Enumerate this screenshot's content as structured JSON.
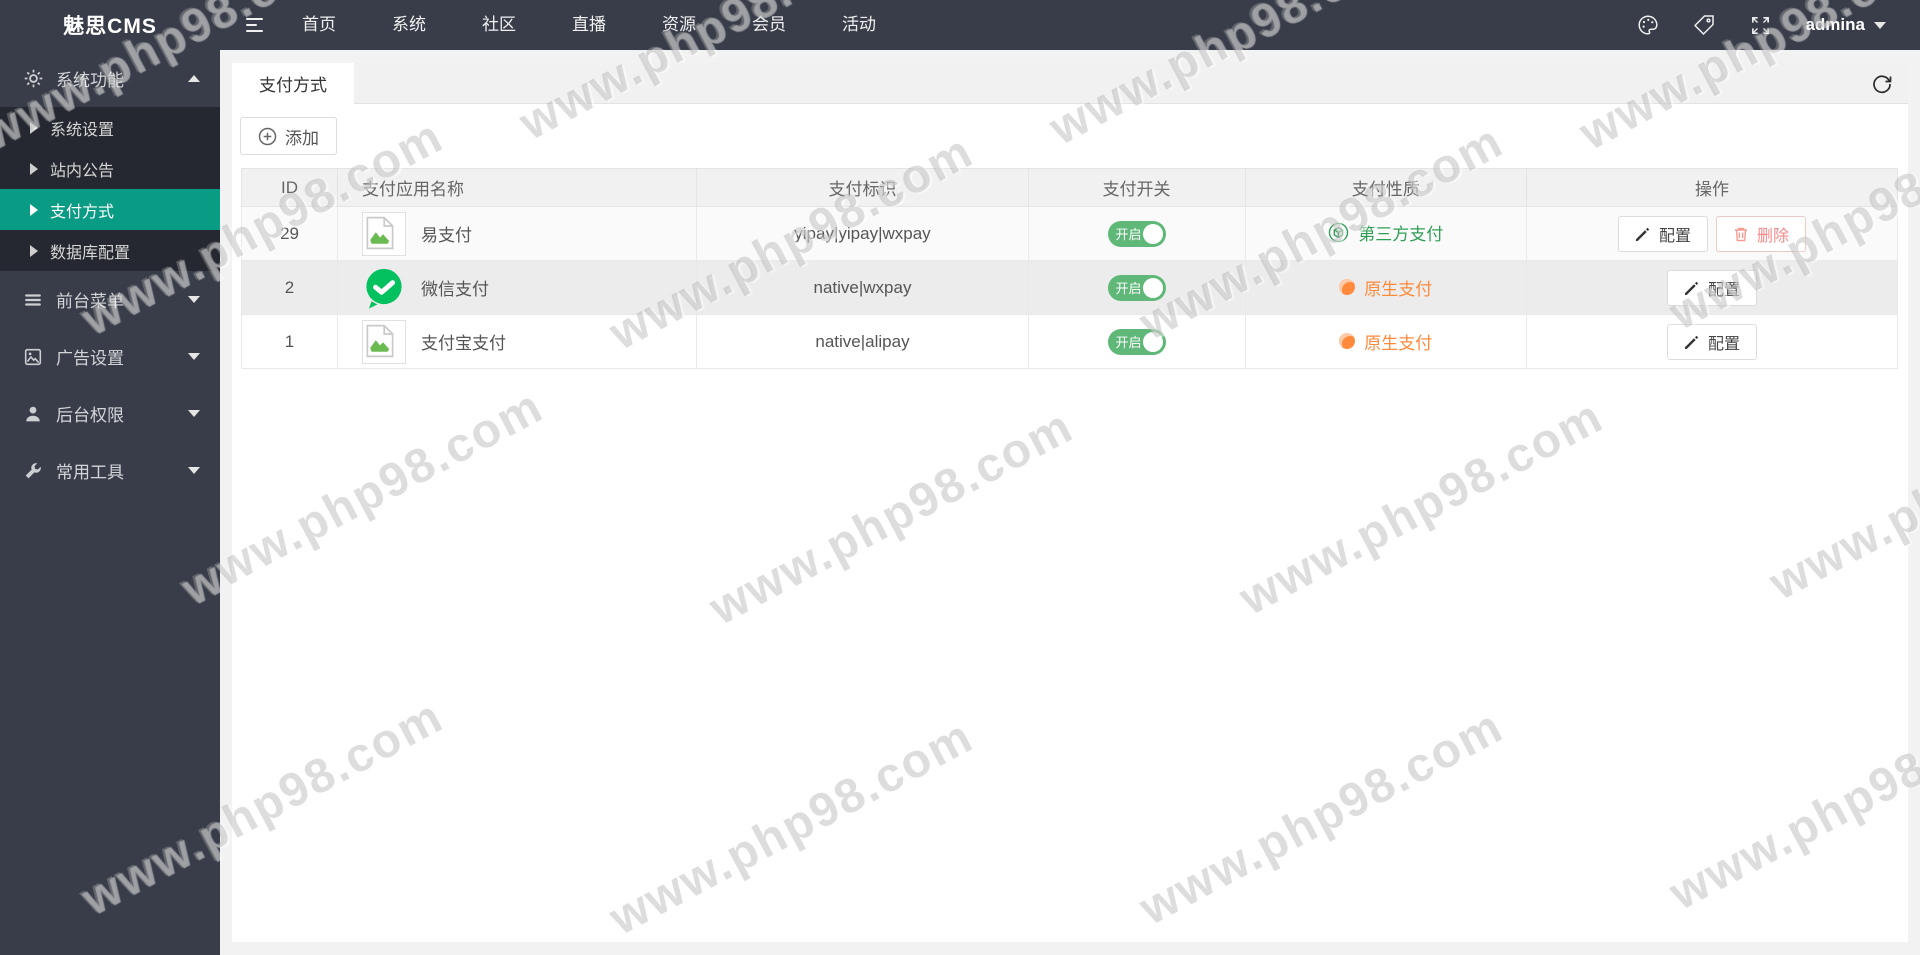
{
  "app": {
    "title": "魅思CMS"
  },
  "navbar": {
    "items": [
      "首页",
      "系统",
      "社区",
      "直播",
      "资源",
      "会员",
      "活动"
    ],
    "user": "admina",
    "icons": [
      "theme-palette-icon",
      "tag-icon",
      "fullscreen-icon"
    ]
  },
  "sidebar": {
    "sections": [
      {
        "label": "系统功能",
        "icon": "gear-icon",
        "expanded": true,
        "children": [
          {
            "label": "系统设置",
            "active": false
          },
          {
            "label": "站内公告",
            "active": false
          },
          {
            "label": "支付方式",
            "active": true
          },
          {
            "label": "数据库配置",
            "active": false
          }
        ]
      },
      {
        "label": "前台菜单",
        "icon": "menu-list-icon",
        "expanded": false
      },
      {
        "label": "广告设置",
        "icon": "ad-image-icon",
        "expanded": false
      },
      {
        "label": "后台权限",
        "icon": "user-icon",
        "expanded": false
      },
      {
        "label": "常用工具",
        "icon": "wrench-icon",
        "expanded": false
      }
    ]
  },
  "tabs": {
    "active": "支付方式"
  },
  "toolbar": {
    "add_label": "添加"
  },
  "table": {
    "headers": [
      "ID",
      "支付应用名称",
      "支付标识",
      "支付开关",
      "支付性质",
      "操作"
    ],
    "config_label": "配置",
    "delete_label": "删除",
    "rows": [
      {
        "id": "29",
        "name": "易支付",
        "icon": "broken-image-placeholder",
        "identifier": "yipay|yipay|wxpay",
        "switch_label": "开启",
        "switch_on": true,
        "nature_label": "第三方支付",
        "nature_type": "third-party",
        "actions": [
          "配置",
          "删除"
        ]
      },
      {
        "id": "2",
        "name": "微信支付",
        "icon": "wechat-pay-icon",
        "identifier": "native|wxpay",
        "switch_label": "开启",
        "switch_on": true,
        "nature_label": "原生支付",
        "nature_type": "native",
        "actions": [
          "配置"
        ]
      },
      {
        "id": "1",
        "name": "支付宝支付",
        "icon": "broken-image-placeholder",
        "identifier": "native|alipay",
        "switch_label": "开启",
        "switch_on": true,
        "nature_label": "原生支付",
        "nature_type": "native",
        "actions": [
          "配置"
        ]
      }
    ]
  },
  "watermark": {
    "text": "www.php98.com"
  },
  "colors": {
    "navbar_bg": "#393D49",
    "sidebar_active": "#0a9b84",
    "switch_on": "#5FB878",
    "third_party_green": "#2f9e57",
    "native_orange": "#ff8a3c",
    "delete_red": "#f78989",
    "wechat_green": "#04C160"
  }
}
